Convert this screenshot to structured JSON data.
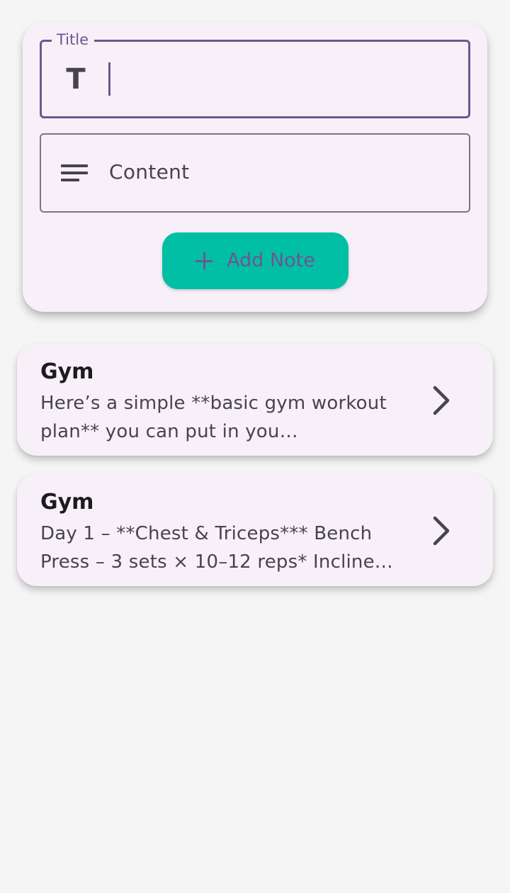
{
  "form": {
    "title_label": "Title",
    "title_icon": "T",
    "title_value": "",
    "content_placeholder": "Content",
    "add_button_label": "Add Note"
  },
  "notes": [
    {
      "title": "Gym",
      "preview": "Here’s a simple **basic gym workout plan** you can put in you…"
    },
    {
      "title": "Gym",
      "preview": "Day 1 – **Chest & Triceps*** Bench Press – 3 sets × 10–12 reps* Incline…"
    }
  ],
  "colors": {
    "accent": "#6e5690",
    "button": "#00bfa5",
    "card": "#f8f0f8",
    "background": "#f5f5f5"
  },
  "icons": {
    "title_field": "title-t-icon",
    "content_field": "notes-lines-icon",
    "add_button": "plus-icon",
    "note_card": "chevron-right-icon"
  }
}
